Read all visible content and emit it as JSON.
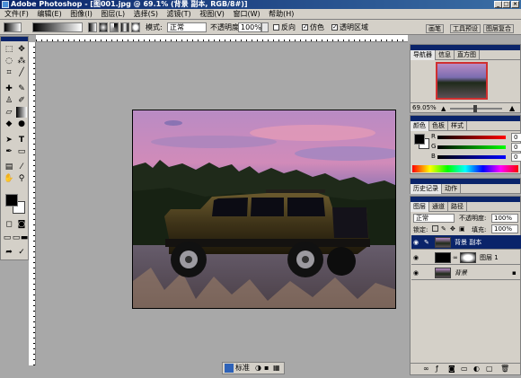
{
  "window": {
    "title": "Adobe Photoshop - [图001.jpg @ 69.1% (背景 副本, RGB/8#)]",
    "controls": [
      "_",
      "□",
      "×"
    ]
  },
  "menu": [
    "文件(F)",
    "编辑(E)",
    "图像(I)",
    "图层(L)",
    "选择(S)",
    "滤镜(T)",
    "视图(V)",
    "窗口(W)",
    "帮助(H)"
  ],
  "options": {
    "mode_label": "模式:",
    "mode_value": "正常",
    "opacity_label": "不透明度:",
    "opacity_value": "100%",
    "reverse_label": "反向",
    "dither_label": "仿色",
    "transparency_label": "透明区域",
    "reverse_checked": false,
    "dither_checked": true,
    "transparency_checked": true
  },
  "palette_well": {
    "tabs": [
      "画笔",
      "工具预设",
      "图层复合"
    ]
  },
  "navigator": {
    "tabs": [
      "导航器",
      "信息",
      "直方图"
    ],
    "zoom": "69.05%"
  },
  "color_panel": {
    "tabs": [
      "颜色",
      "色板",
      "样式"
    ],
    "channels": [
      {
        "label": "R",
        "value": "0"
      },
      {
        "label": "G",
        "value": "0"
      },
      {
        "label": "B",
        "value": "0"
      }
    ]
  },
  "history_panel": {
    "tabs": [
      "历史记录",
      "动作"
    ]
  },
  "layers_panel": {
    "tabs": [
      "图层",
      "通道",
      "路径"
    ],
    "blend_mode": "正常",
    "opacity_label": "不透明度:",
    "opacity_value": "100%",
    "lock_label": "锁定:",
    "fill_label": "填充:",
    "fill_value": "100%",
    "layers": [
      {
        "name": "背景 副本",
        "selected": true
      },
      {
        "name": "图层 1",
        "selected": false
      },
      {
        "name": "背景",
        "selected": false
      }
    ]
  },
  "statusbar": {
    "label": "标准"
  },
  "colors": {
    "title_bar": "#0a246a",
    "selected_layer": "#0a246a",
    "foreground": "#000000",
    "background": "#ffffff"
  }
}
